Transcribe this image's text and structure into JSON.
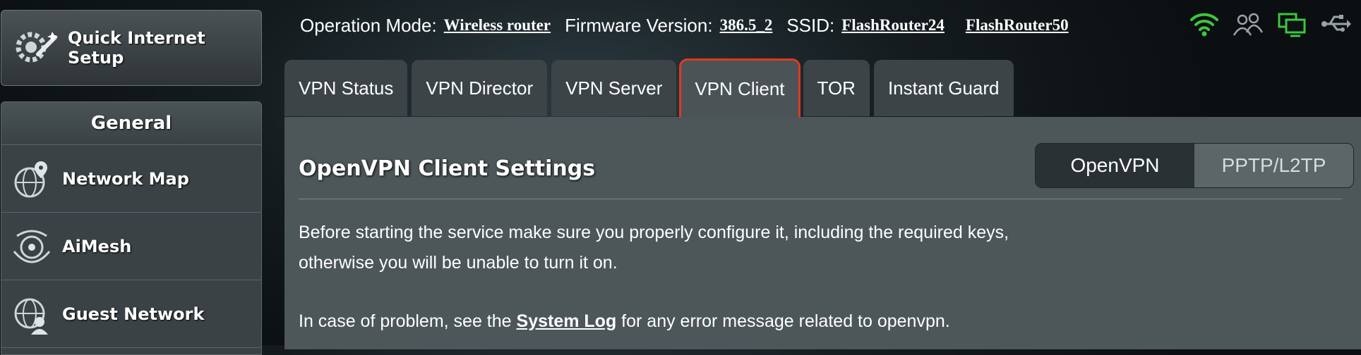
{
  "sidebar": {
    "quick_setup": {
      "label": "Quick Internet\nSetup",
      "icon": "wizard-gear-icon"
    },
    "general_title": "General",
    "items": [
      {
        "label": "Network Map",
        "icon": "globe-pin-icon"
      },
      {
        "label": "AiMesh",
        "icon": "aimesh-icon"
      },
      {
        "label": "Guest Network",
        "icon": "guest-globe-icon"
      }
    ]
  },
  "topbar": {
    "operation_mode_label": "Operation Mode:",
    "operation_mode_value": "Wireless router",
    "firmware_label": "Firmware Version:",
    "firmware_value": "386.5_2",
    "ssid_label": "SSID:",
    "ssid_1": "FlashRouter24",
    "ssid_2": "FlashRouter50",
    "icons": [
      "wifi-icon",
      "clients-icon",
      "network-status-icon",
      "usb-icon"
    ]
  },
  "tabs": [
    {
      "label": "VPN Status"
    },
    {
      "label": "VPN Director"
    },
    {
      "label": "VPN Server"
    },
    {
      "label": "VPN Client",
      "active": true
    },
    {
      "label": "TOR"
    },
    {
      "label": "Instant Guard"
    }
  ],
  "content": {
    "heading": "OpenVPN Client Settings",
    "toggle": {
      "openvpn": "OpenVPN",
      "pptp": "PPTP/L2TP"
    },
    "para1_line1": "Before starting the service make sure you properly configure it, including the required keys,",
    "para1_line2": "otherwise you will be unable to turn it on.",
    "para2_before": "In case of problem, see the ",
    "para2_link": "System Log",
    "para2_after": " for any error message related to openvpn."
  },
  "colors": {
    "active_tab_outline": "#e03a1e",
    "status_green": "#3ec63e"
  }
}
